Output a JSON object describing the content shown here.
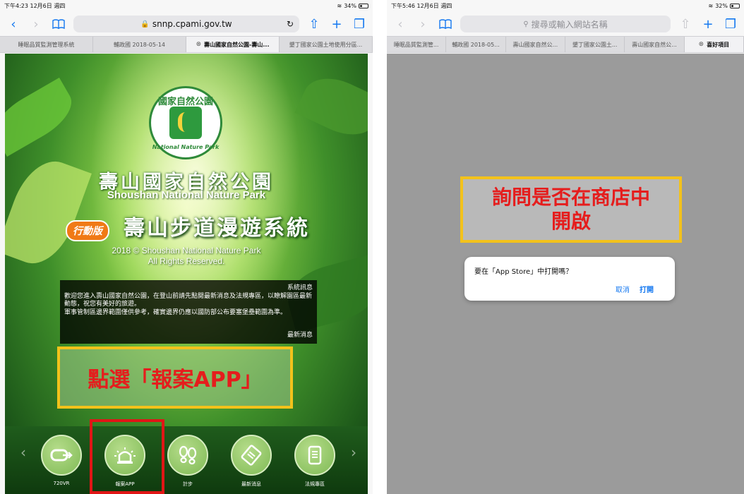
{
  "left": {
    "status": {
      "time_date": "下午4:23  12月6日 週四",
      "battery": "34%",
      "battery_level": 0.34
    },
    "toolbar": {
      "url": "snnp.cpami.gov.tw"
    },
    "tabs": [
      "睡眠品質監測管理系統",
      "輔政國 2018-05-14",
      "壽山國家自然公園-壽山...",
      "墾丁國家公園土地使用分區..."
    ],
    "logo": {
      "top_text": "國家自然公園",
      "bottom_text": "National Nature Park"
    },
    "park_name_cn": "壽山國家自然公園",
    "park_name_en": "Shoushan National Nature Park",
    "mobile_badge": "行動版",
    "system_title": "壽山步道漫遊系統",
    "copyright_line1": "2018 © Shoushan National Nature Park",
    "copyright_line2": "All Rights Reserved.",
    "notice": {
      "title": "系統訊息",
      "body1": "歡迎您進入壽山國家自然公園，在登山前請先點閱最新消息及法規專區，以瞭解園區最新動態，祝您有美好的旅遊。",
      "body2": "軍事管制區邊界範圍僅供參考，確實邊界仍應以國防部公布要塞堡壘範圍為準。",
      "more": "最新消息"
    },
    "callout": "點選「報案APP」",
    "nav": [
      {
        "label": "720VR",
        "icon": "vr-icon"
      },
      {
        "label": "報案APP",
        "icon": "siren-icon"
      },
      {
        "label": "計步",
        "icon": "footprints-icon"
      },
      {
        "label": "最新消息",
        "icon": "news-icon"
      },
      {
        "label": "法規專區",
        "icon": "scroll-icon"
      }
    ]
  },
  "right": {
    "status": {
      "time_date": "下午5:46  12月6日 週四",
      "battery": "32%",
      "battery_level": 0.32
    },
    "toolbar": {
      "placeholder": "搜尋或輸入網站名稱"
    },
    "tabs": [
      "睡眠品質監測管...",
      "輔政國 2018-05...",
      "壽山國家自然公...",
      "墾丁國家公園土...",
      "壽山國家自然公...",
      "喜好項目"
    ],
    "callout_line1": "詢問是否在商店中",
    "callout_line2": "開啟",
    "dialog": {
      "message": "要在「App Store」中打開嗎？",
      "cancel": "取消",
      "open": "打開"
    }
  }
}
